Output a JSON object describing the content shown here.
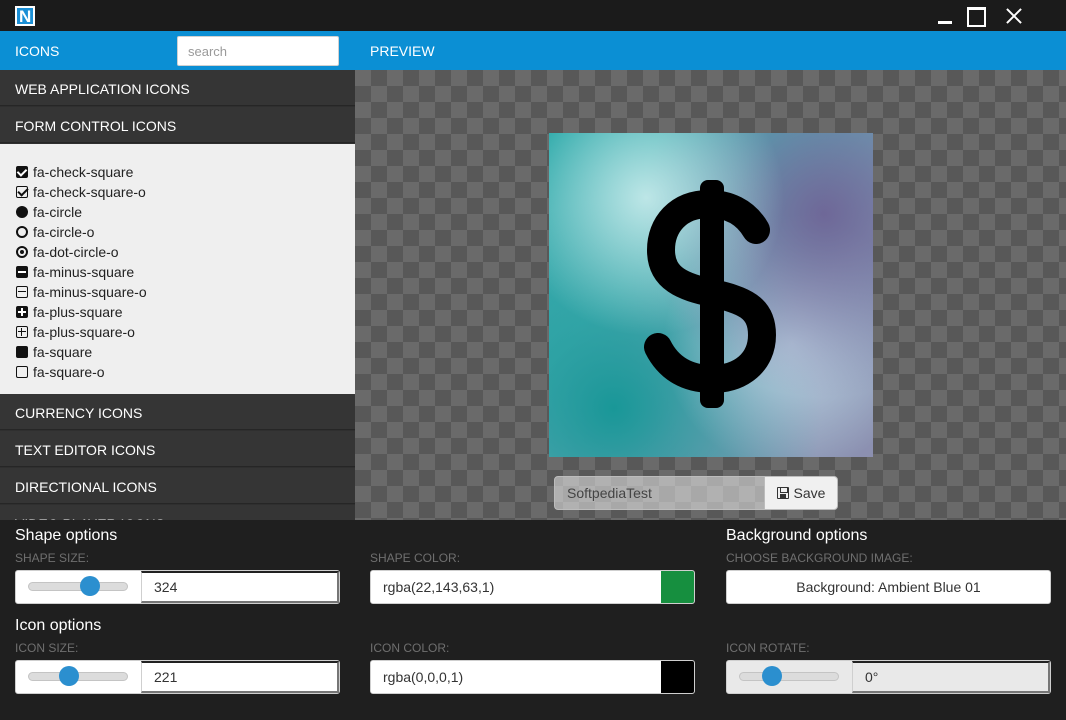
{
  "window": {
    "logo_letter": "N"
  },
  "header": {
    "icons_title": "ICONS",
    "search_placeholder": "search",
    "preview_title": "PREVIEW"
  },
  "sidebar": {
    "categories_top": [
      "WEB APPLICATION ICONS",
      "FORM CONTROL ICONS"
    ],
    "expanded_items": [
      {
        "label": "fa-check-square",
        "icon": "check-square-icon"
      },
      {
        "label": "fa-check-square-o",
        "icon": "check-square-o-icon"
      },
      {
        "label": "fa-circle",
        "icon": "circle-icon"
      },
      {
        "label": "fa-circle-o",
        "icon": "circle-o-icon"
      },
      {
        "label": "fa-dot-circle-o",
        "icon": "dot-circle-o-icon"
      },
      {
        "label": "fa-minus-square",
        "icon": "minus-square-icon"
      },
      {
        "label": "fa-minus-square-o",
        "icon": "minus-square-o-icon"
      },
      {
        "label": "fa-plus-square",
        "icon": "plus-square-icon"
      },
      {
        "label": "fa-plus-square-o",
        "icon": "plus-square-o-icon"
      },
      {
        "label": "fa-square",
        "icon": "square-icon"
      },
      {
        "label": "fa-square-o",
        "icon": "square-o-icon"
      }
    ],
    "categories_bottom": [
      "CURRENCY ICONS",
      "TEXT EDITOR ICONS",
      "DIRECTIONAL ICONS",
      "VIDEO PLAYER ICONS"
    ]
  },
  "preview": {
    "icon": "dollar-icon",
    "filename": "SoftpediaTest",
    "save_label": "Save"
  },
  "shape_options": {
    "title": "Shape options",
    "size_label": "SHAPE SIZE:",
    "size_value": "324",
    "size_slider_fraction": 0.62,
    "color_label": "SHAPE COLOR:",
    "color_value": "rgba(22,143,63,1)",
    "color_swatch": "#168f3f"
  },
  "background_options": {
    "title": "Background options",
    "choose_label": "CHOOSE BACKGROUND IMAGE:",
    "button_label": "Background: Ambient Blue 01"
  },
  "icon_options": {
    "title": "Icon options",
    "size_label": "ICON SIZE:",
    "size_value": "221",
    "size_slider_fraction": 0.41,
    "color_label": "ICON COLOR:",
    "color_value": "rgba(0,0,0,1)",
    "color_swatch": "#000000",
    "rotate_label": "ICON ROTATE:",
    "rotate_value": "0°",
    "rotate_slider_fraction": 0.33
  },
  "colors": {
    "accent": "#0b8fd4",
    "slider_thumb": "#2b8fcf"
  }
}
